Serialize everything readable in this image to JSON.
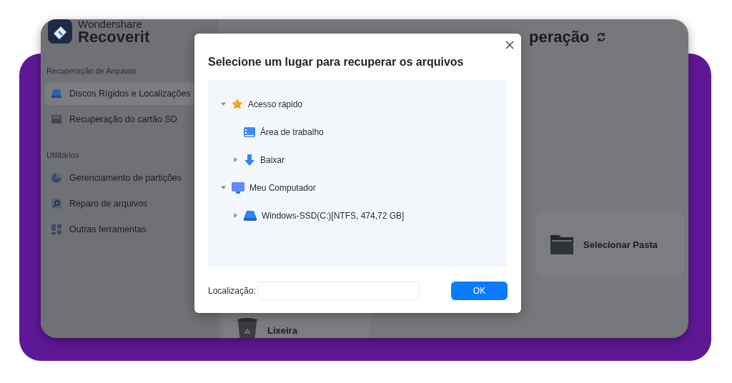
{
  "app": {
    "logo": {
      "brand": "Wondershare",
      "product": "Recoverit"
    },
    "sidebar": {
      "sections": [
        {
          "title": "Recuperação de Arquivos",
          "items": [
            {
              "label": "Discos Rígidos e Localizações",
              "kind": "drive",
              "selected": true
            },
            {
              "label": "Recuperação do cartão SD",
              "kind": "sdcard",
              "selected": false
            }
          ]
        },
        {
          "title": "Utilitários",
          "items": [
            {
              "label": "Gerenciamento de partições",
              "kind": "pie",
              "selected": false
            },
            {
              "label": "Reparo de arquivos",
              "kind": "repair",
              "selected": false
            },
            {
              "label": "Outras ferramentas",
              "kind": "grid",
              "selected": false
            }
          ]
        }
      ]
    },
    "main": {
      "heading": "peração",
      "cards": [
        {
          "label": "Selecionar Pasta",
          "kind": "folder"
        },
        {
          "label": "Lixeira",
          "kind": "trash"
        }
      ]
    }
  },
  "dialog": {
    "title": "Selecione um lugar para recuperar os arquivos",
    "tree": [
      {
        "label": "Acesso rápido",
        "kind": "star",
        "expanded": true,
        "children": [
          {
            "label": "Área de trabalho",
            "kind": "desktop"
          },
          {
            "label": "Baixar",
            "kind": "download",
            "expanded": false
          }
        ]
      },
      {
        "label": "Meu Computador",
        "kind": "monitor",
        "expanded": true,
        "children": [
          {
            "label": "Windows-SSD(C:)[NTFS, 474,72 GB]",
            "kind": "disk",
            "expanded": false
          }
        ]
      }
    ],
    "location": {
      "label": "Localização:"
    },
    "ok": "OK"
  }
}
